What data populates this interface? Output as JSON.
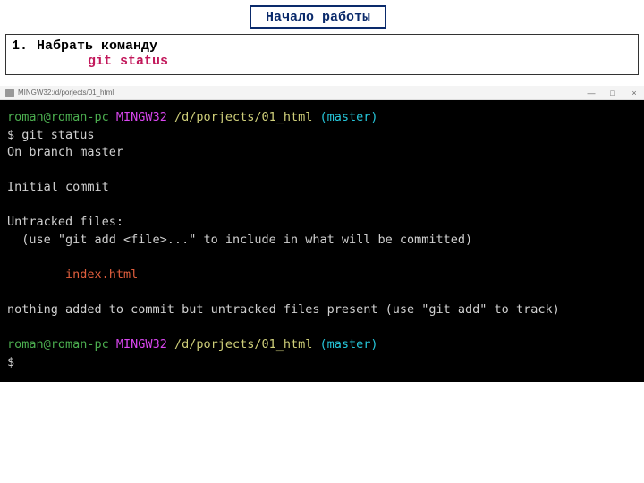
{
  "header": {
    "title": "Начало работы"
  },
  "instruction": {
    "num": "1.",
    "text": "Набрать команду",
    "command": "git status"
  },
  "window": {
    "title": "MINGW32:/d/porjects/01_html",
    "controls": {
      "min": "—",
      "max": "□",
      "close": "×"
    }
  },
  "term": {
    "p1_user": "roman@roman-pc",
    "p1_sys": " MINGW32",
    "p1_path": " /d/porjects/01_html",
    "p1_branch": " (master)",
    "l1": "$ git status",
    "l2": "On branch master",
    "blank": "",
    "l3": "Initial commit",
    "l4": "Untracked files:",
    "l5": "  (use \"git add <file>...\" to include in what will be committed)",
    "l6": "        index.html",
    "l7": "nothing added to commit but untracked files present (use \"git add\" to track)",
    "p2_user": "roman@roman-pc",
    "p2_sys": " MINGW32",
    "p2_path": " /d/porjects/01_html",
    "p2_branch": " (master)",
    "l8": "$"
  }
}
